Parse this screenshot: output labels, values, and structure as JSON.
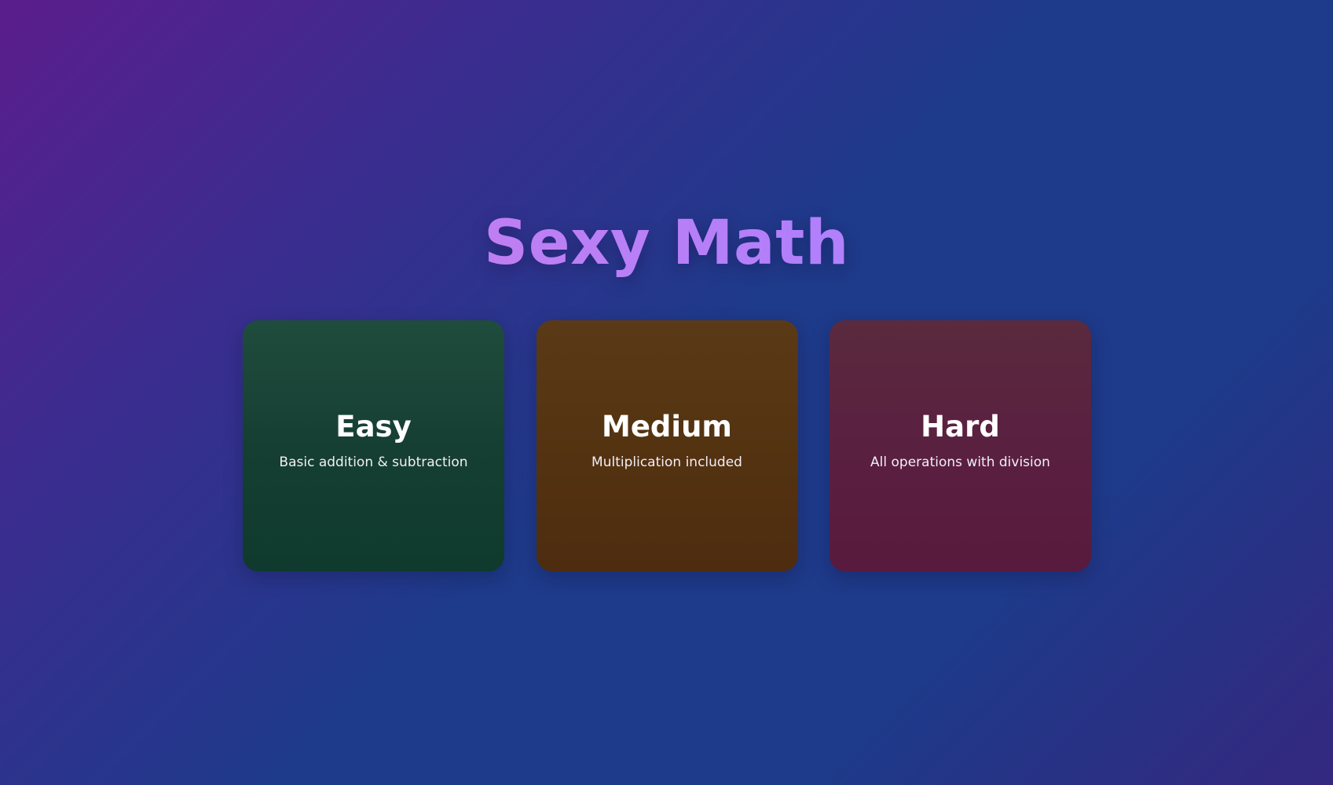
{
  "title": "Sexy Math",
  "cards": [
    {
      "label": "Easy",
      "description": "Basic addition & subtraction",
      "color": "#1f4c3d"
    },
    {
      "label": "Medium",
      "description": "Multiplication included",
      "color": "#5a3a16"
    },
    {
      "label": "Hard",
      "description": "All operations with division",
      "color": "#5a2040"
    }
  ],
  "colors": {
    "title_gradient_start": "#d17ee6",
    "title_gradient_end": "#a78bfa",
    "background_start": "#5b1d8c",
    "background_end": "#1e3a8a"
  }
}
